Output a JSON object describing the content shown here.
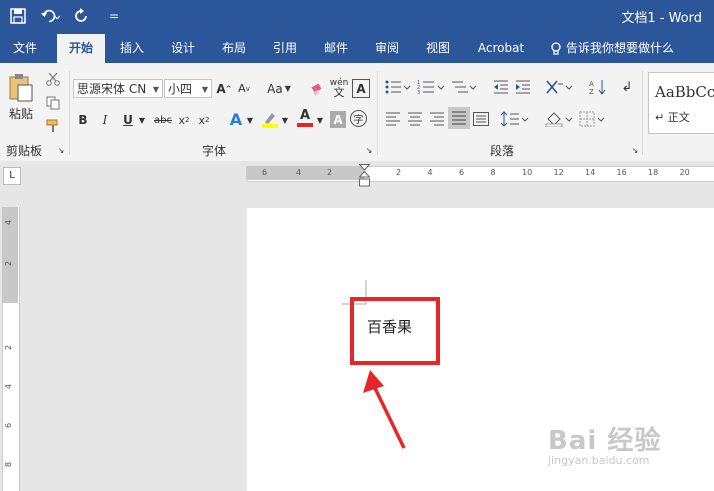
{
  "window": {
    "title": "文档1  -  Word"
  },
  "tabs": [
    "文件",
    "开始",
    "插入",
    "设计",
    "布局",
    "引用",
    "邮件",
    "审阅",
    "视图",
    "Acrobat"
  ],
  "tell_me": "告诉我你想要做什么",
  "clipboard": {
    "paste_label": "粘贴",
    "group_label": "剪贴板"
  },
  "font": {
    "name": "思源宋体 CN",
    "size": "小四",
    "group_label": "字体",
    "aa_label": "Aa",
    "pinyin_label": "wén"
  },
  "paragraph": {
    "group_label": "段落"
  },
  "styles": {
    "preview": "AaBbCc",
    "normal_label": "↵ 正文"
  },
  "ruler": {
    "h_left": [
      "6",
      "4",
      "2"
    ],
    "h_right": [
      "2",
      "4",
      "6",
      "8",
      "10",
      "12",
      "14",
      "16",
      "18",
      "20"
    ],
    "v": [
      "4",
      "2",
      "2",
      "4",
      "6",
      "8"
    ]
  },
  "document": {
    "text": "百香果"
  },
  "watermark": {
    "brand": "Bai 经验",
    "url": "jingyan.baidu.com"
  },
  "colors": {
    "ribbon_blue": "#2b579a",
    "highlight_red": "#e8262a"
  }
}
